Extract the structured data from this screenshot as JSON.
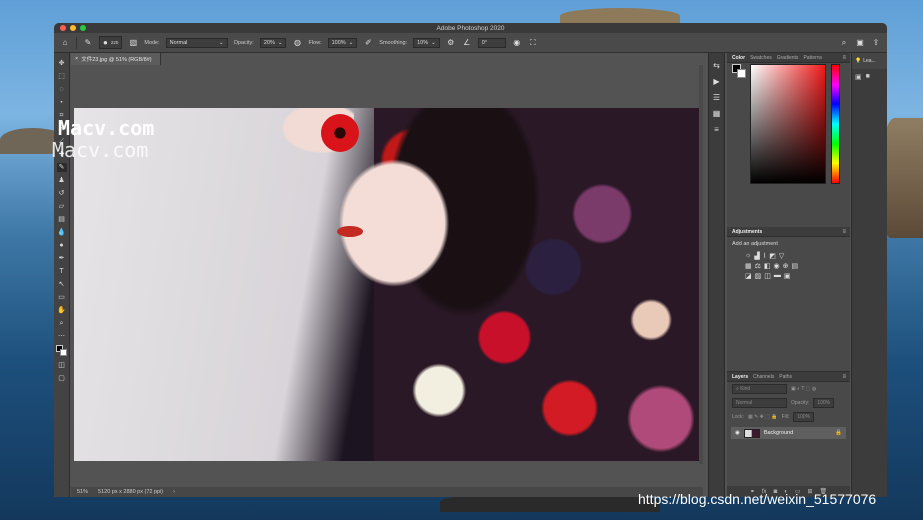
{
  "watermark": {
    "line1": "Macv.com",
    "line2": "Macv.com"
  },
  "csdn_url": "https://blog.csdn.net/weixin_51577076",
  "window": {
    "title": "Adobe Photoshop 2020"
  },
  "options": {
    "brush_size": "220",
    "mode_label": "Mode:",
    "mode_value": "Normal",
    "opacity_label": "Opacity:",
    "opacity_value": "20%",
    "flow_label": "Flow:",
    "flow_value": "100%",
    "smoothing_label": "Smoothing:",
    "smoothing_value": "10%",
    "angle_value": "0°"
  },
  "document": {
    "tab": "文件23.jpg @ 51% (RGB/8#)",
    "zoom": "51%",
    "dimensions": "5120 px x 2880 px (72 ppi)"
  },
  "color_panel": {
    "tabs": [
      "Color",
      "Swatches",
      "Gradients",
      "Patterns"
    ]
  },
  "adjustments": {
    "tab": "Adjustments",
    "label": "Add an adjustment"
  },
  "layers": {
    "tabs": [
      "Layers",
      "Channels",
      "Paths"
    ],
    "kind": "Kind",
    "blend": "Normal",
    "opacity_label": "Opacity:",
    "opacity_value": "100%",
    "lock_label": "Lock:",
    "fill_label": "Fill:",
    "fill_value": "100%",
    "layer_name": "Background"
  },
  "learn": {
    "label": "Lea..."
  },
  "colors": {
    "accent_red": "#f21a1a",
    "panel_bg": "#494949",
    "canvas_bg": "#535353"
  }
}
